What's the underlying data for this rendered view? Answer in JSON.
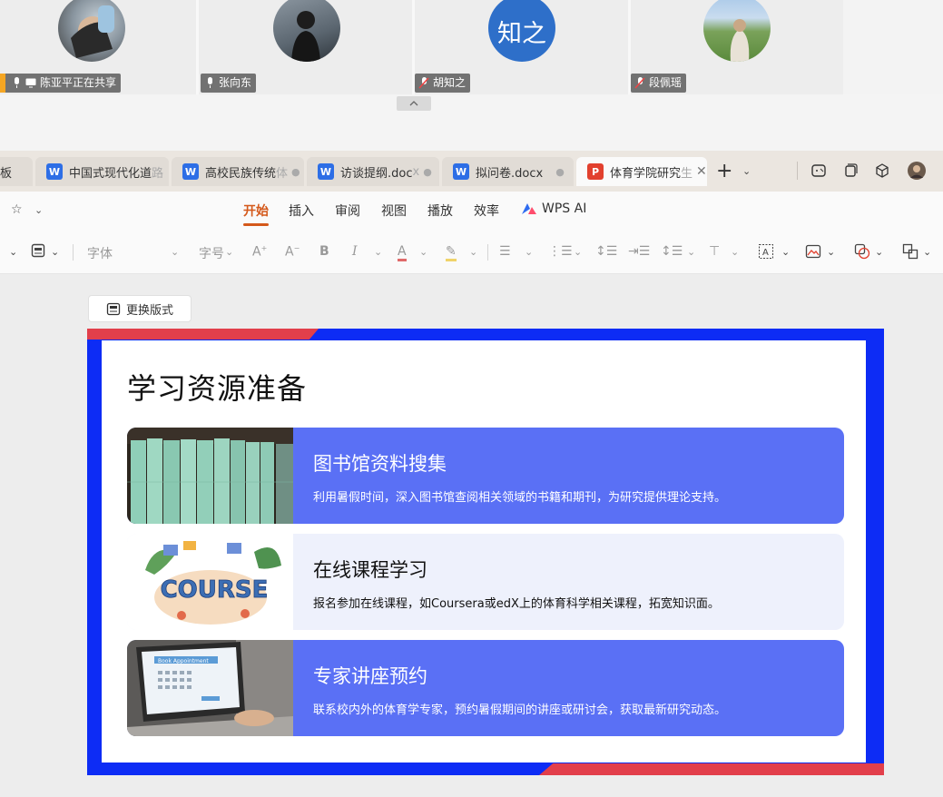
{
  "meeting": {
    "participants": [
      {
        "name": "陈亚平正在共享",
        "status": "sharing"
      },
      {
        "name": "张向东",
        "status": "mic-on"
      },
      {
        "name": "胡知之",
        "status": "muted",
        "avatar_text": "知之"
      },
      {
        "name": "段佩瑶",
        "status": "muted"
      }
    ]
  },
  "tabs": [
    {
      "label_partial": "板"
    },
    {
      "label": "中国式现代化道",
      "label_faded": "路",
      "badge": "W"
    },
    {
      "label": "高校民族传统",
      "label_faded": "体",
      "badge": "W",
      "dot": "●"
    },
    {
      "label": "访谈提纲.doc",
      "label_faded": "x",
      "badge": "W",
      "dot": "●"
    },
    {
      "label": "拟问卷.docx",
      "badge": "W",
      "dot": "●"
    },
    {
      "label": "体育学院研究",
      "label_faded": "生",
      "badge": "P",
      "close": "✕"
    }
  ],
  "ribbon": {
    "tabs": [
      "开始",
      "插入",
      "审阅",
      "视图",
      "播放",
      "效率",
      "WPS AI"
    ],
    "active": "开始"
  },
  "toolbar": {
    "font_placeholder": "字体",
    "size_placeholder": "字号"
  },
  "canvas": {
    "layout_button": "更换版式"
  },
  "slide": {
    "title": "学习资源准备",
    "cards": [
      {
        "title": "图书馆资料搜集",
        "desc": "利用暑假时间，深入图书馆查阅相关领域的书籍和期刊，为研究提供理论支持。"
      },
      {
        "title": "在线课程学习",
        "desc": "报名参加在线课程，如Coursera或edX上的体育科学相关课程，拓宽知识面。",
        "image_text": "COURSE"
      },
      {
        "title": "专家讲座预约",
        "desc": "联系校内外的体育学专家，预约暑假期间的讲座或研讨会，获取最新研究动态。",
        "image_text": "Book Appointment"
      }
    ]
  },
  "colors": {
    "slide_frame": "#0d2cf5",
    "accent_red": "#e23f4b",
    "card_blue": "#5a70f5",
    "card_light": "#eef1fc",
    "ribbon_active": "#d4581a"
  }
}
